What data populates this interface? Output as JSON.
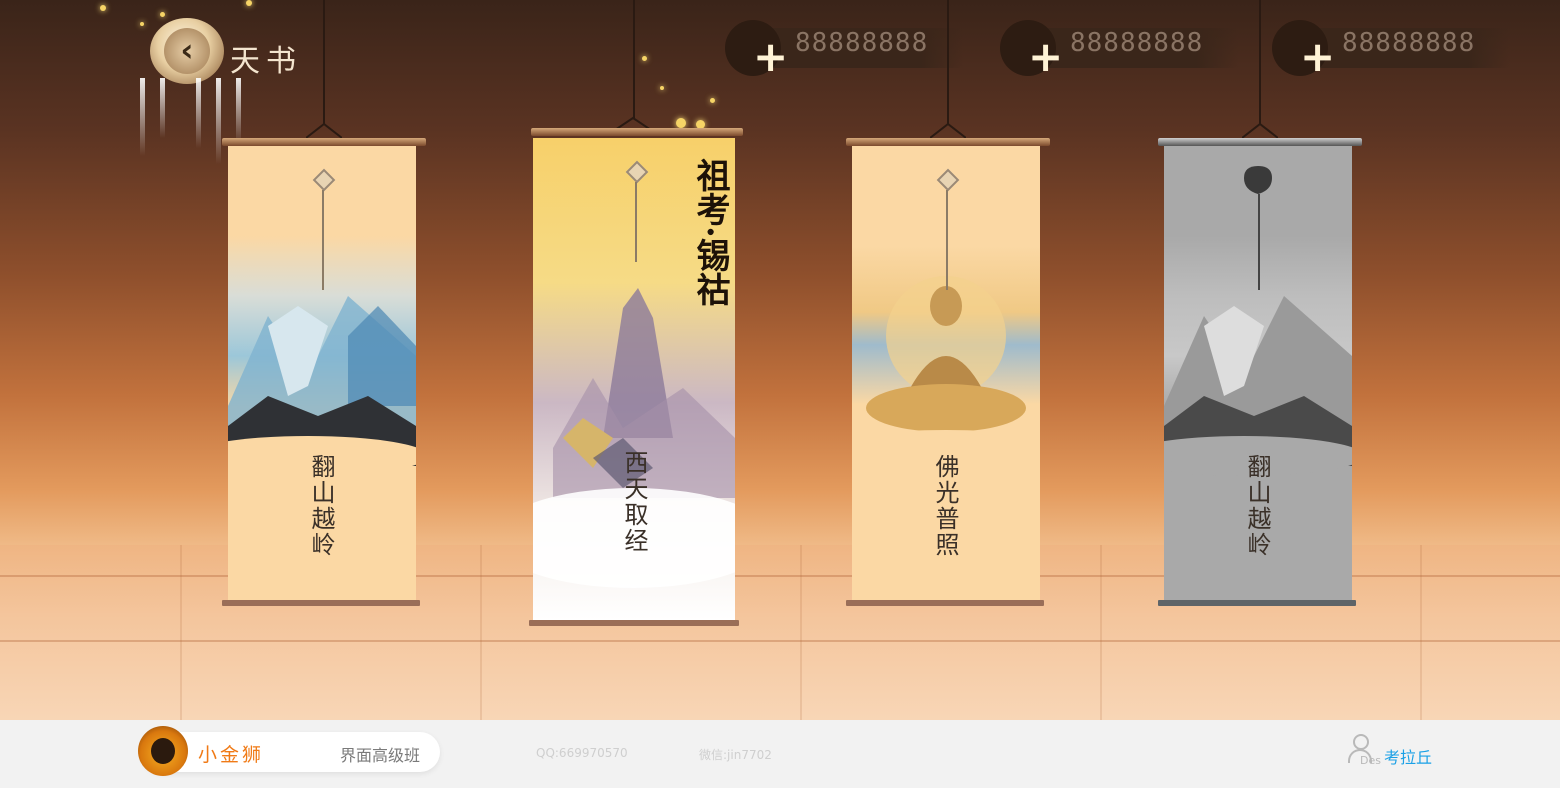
{
  "header": {
    "title": "天书",
    "back_icon": "chevron-left-icon"
  },
  "currencies": [
    {
      "plus": "+",
      "value": "88888888"
    },
    {
      "plus": "+",
      "value": "88888888"
    },
    {
      "plus": "+",
      "value": "88888888"
    }
  ],
  "scrolls": [
    {
      "title": "翻山越岭",
      "state": "normal"
    },
    {
      "title": "西天取经",
      "state": "selected",
      "seal": "祖考·锡祜"
    },
    {
      "title": "佛光普照",
      "state": "normal"
    },
    {
      "title": "翻山越岭",
      "state": "locked"
    }
  ],
  "footer": {
    "brand": "小金狮",
    "course": "界面高级班",
    "qq": "QQ:669970570",
    "wechat": "微信:jin7702",
    "des": "Des",
    "author": "考拉丘"
  },
  "colors": {
    "brand_orange": "#f07a16",
    "author_blue": "#1aa0e6",
    "scroll_paper": "#fbd8a4",
    "locked_gray": "#a9a9a9"
  }
}
